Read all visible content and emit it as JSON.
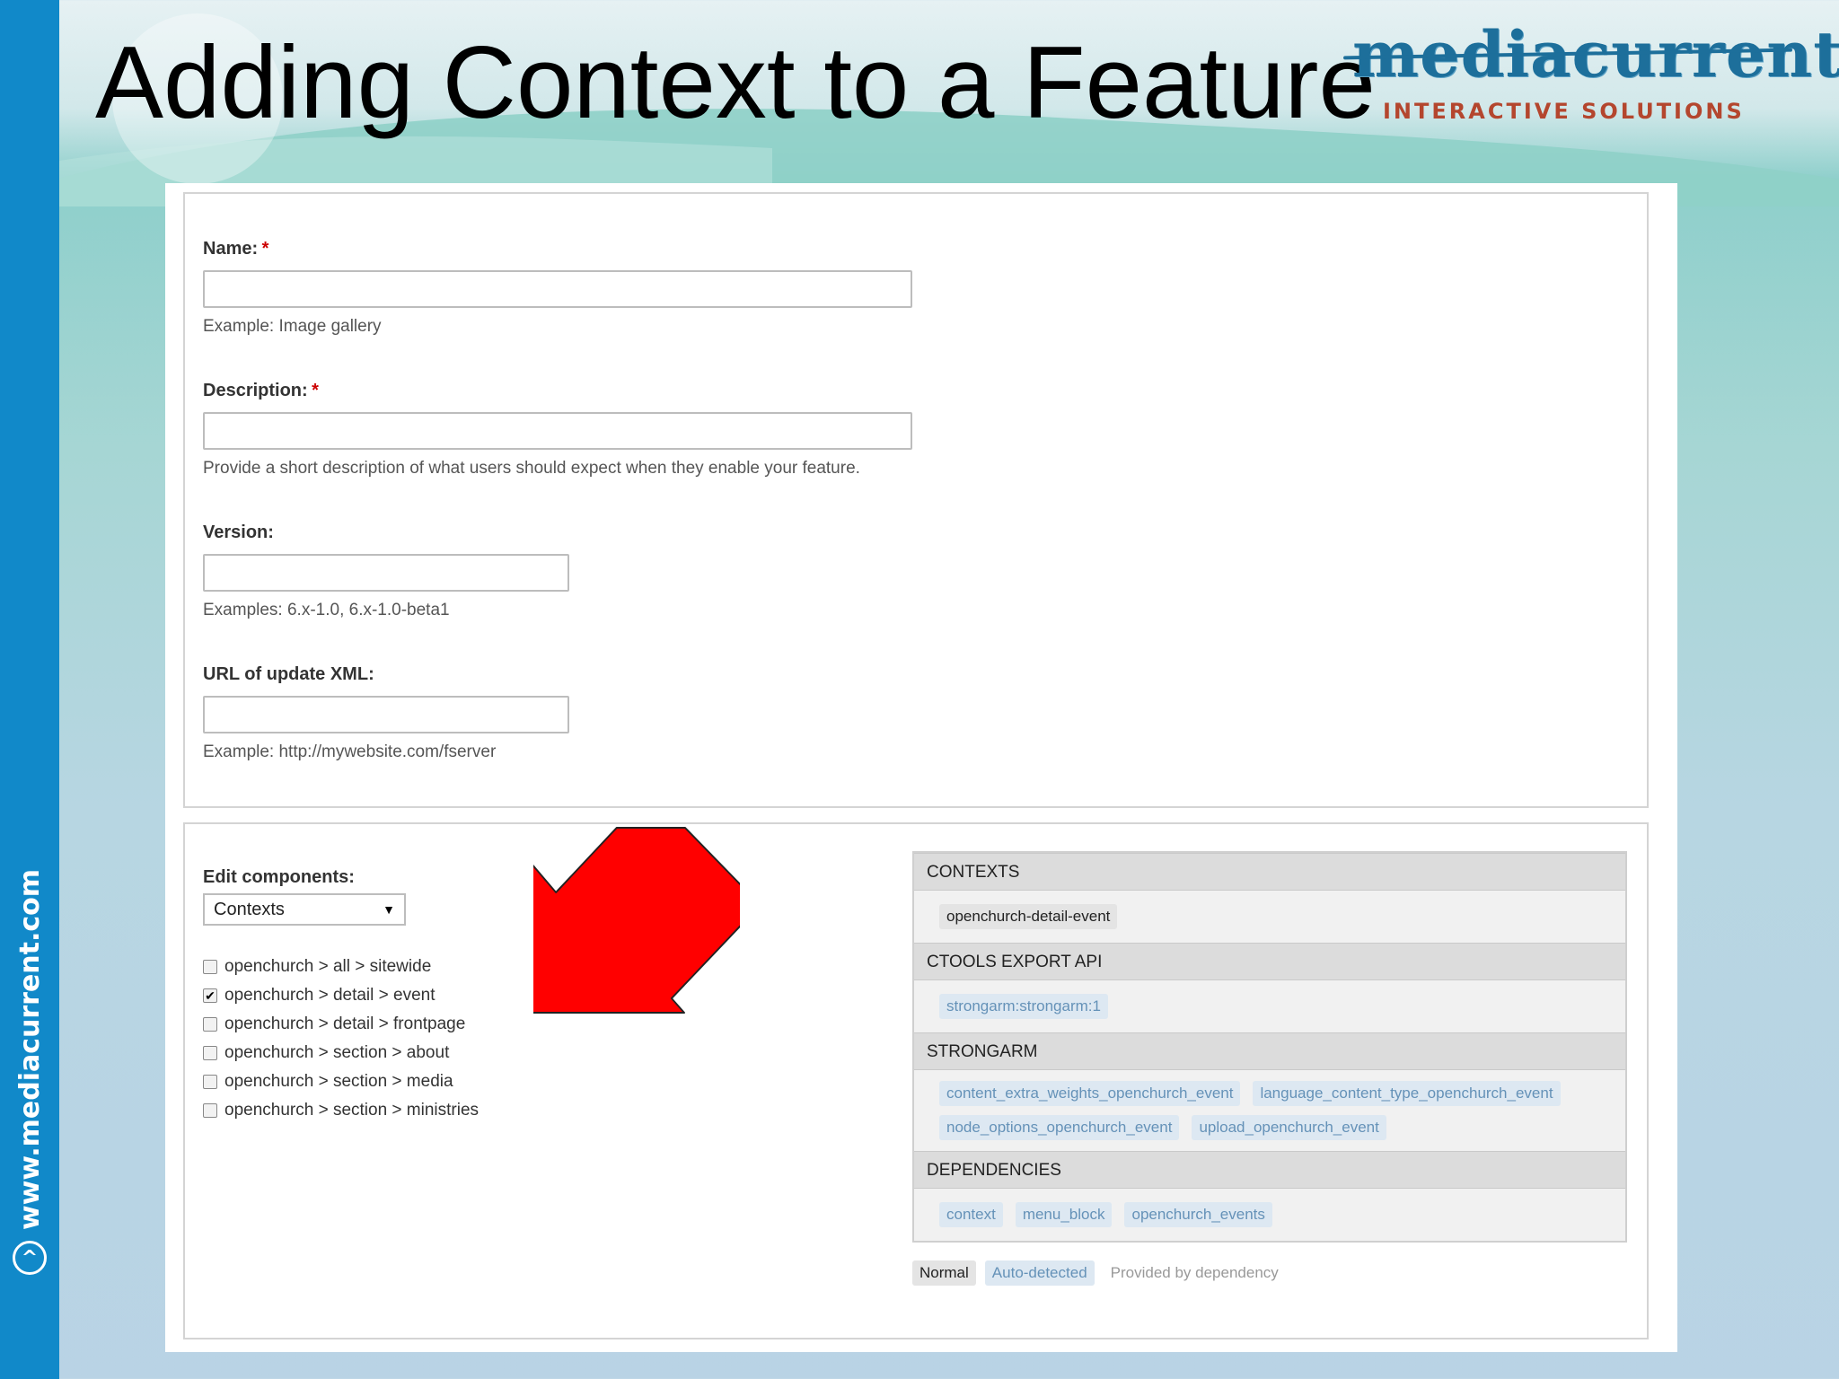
{
  "slide": {
    "title": "Adding Context to a Feature",
    "side_url": "www.mediacurrent.com",
    "logo": {
      "word": "mediacurrent",
      "tagline": "INTERACTIVE SOLUTIONS"
    }
  },
  "form": {
    "name": {
      "label": "Name:",
      "required": "*",
      "value": "",
      "hint": "Example: Image gallery"
    },
    "description": {
      "label": "Description:",
      "required": "*",
      "value": "",
      "hint": "Provide a short description of what users should expect when they enable your feature."
    },
    "version": {
      "label": "Version:",
      "value": "",
      "hint": "Examples: 6.x-1.0, 6.x-1.0-beta1"
    },
    "url_xml": {
      "label": "URL of update XML:",
      "value": "",
      "hint": "Example: http://mywebsite.com/fserver"
    }
  },
  "edit_components": {
    "label": "Edit components:",
    "selected": "Contexts",
    "options": [
      {
        "label": "openchurch > all > sitewide",
        "checked": false
      },
      {
        "label": "openchurch > detail > event",
        "checked": true
      },
      {
        "label": "openchurch > detail > frontpage",
        "checked": false
      },
      {
        "label": "openchurch > section > about",
        "checked": false
      },
      {
        "label": "openchurch > section > media",
        "checked": false
      },
      {
        "label": "openchurch > section > ministries",
        "checked": false
      }
    ]
  },
  "components": {
    "sections": [
      {
        "heading": "CONTEXTS",
        "items": [
          {
            "text": "openchurch-detail-event",
            "kind": "normal"
          }
        ]
      },
      {
        "heading": "CTOOLS EXPORT API",
        "items": [
          {
            "text": "strongarm:strongarm:1",
            "kind": "auto"
          }
        ]
      },
      {
        "heading": "STRONGARM",
        "items": [
          {
            "text": "content_extra_weights_openchurch_event",
            "kind": "auto"
          },
          {
            "text": "language_content_type_openchurch_event",
            "kind": "auto"
          },
          {
            "text": "node_options_openchurch_event",
            "kind": "auto"
          },
          {
            "text": "upload_openchurch_event",
            "kind": "auto"
          }
        ]
      },
      {
        "heading": "DEPENDENCIES",
        "items": [
          {
            "text": "context",
            "kind": "auto"
          },
          {
            "text": "menu_block",
            "kind": "auto"
          },
          {
            "text": "openchurch_events",
            "kind": "auto"
          }
        ]
      }
    ],
    "legend": {
      "normal": "Normal",
      "auto": "Auto-detected",
      "dependency": "Provided by dependency"
    }
  },
  "colors": {
    "side_band": "#1189c9",
    "arrow": "#ff0000",
    "required": "#cc0000",
    "auto_tag_text": "#6592b8"
  }
}
